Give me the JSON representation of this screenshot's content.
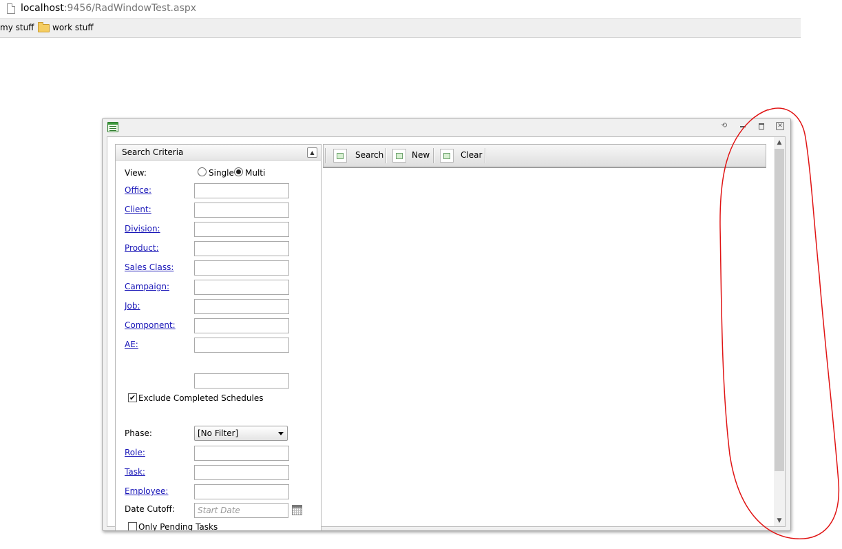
{
  "browser": {
    "url_host": "localhost",
    "url_rest": ":9456/RadWindowTest.aspx",
    "bookmarks": [
      "my stuff",
      "work stuff"
    ]
  },
  "window": {
    "icon": "window-app-icon",
    "controls": [
      "reload-icon",
      "minimize-icon",
      "maximize-icon",
      "close-icon"
    ]
  },
  "search_panel": {
    "title": "Search Criteria",
    "view_label": "View:",
    "view_options": [
      "Single",
      "Multi"
    ],
    "view_selected": "Multi",
    "fields": [
      "Office:",
      "Client:",
      "Division:",
      "Product:",
      "Sales Class:",
      "Campaign:",
      "Job:",
      "Component:",
      "AE:"
    ],
    "exclude_label": "Exclude Completed Schedules",
    "exclude_checked": true,
    "phase_label": "Phase:",
    "phase_value": "[No Filter]",
    "fields2": [
      "Role:",
      "Task:",
      "Employee:"
    ],
    "date_label": "Date Cutoff:",
    "date_placeholder": "Start Date",
    "partial_checkbox_label": "Only Pending Tasks"
  },
  "toolbar": {
    "search_label": "Search",
    "new_label": "New",
    "clear_label": "Clear"
  },
  "colors": {
    "link": "#1a17b8",
    "annotation": "#e01414"
  }
}
